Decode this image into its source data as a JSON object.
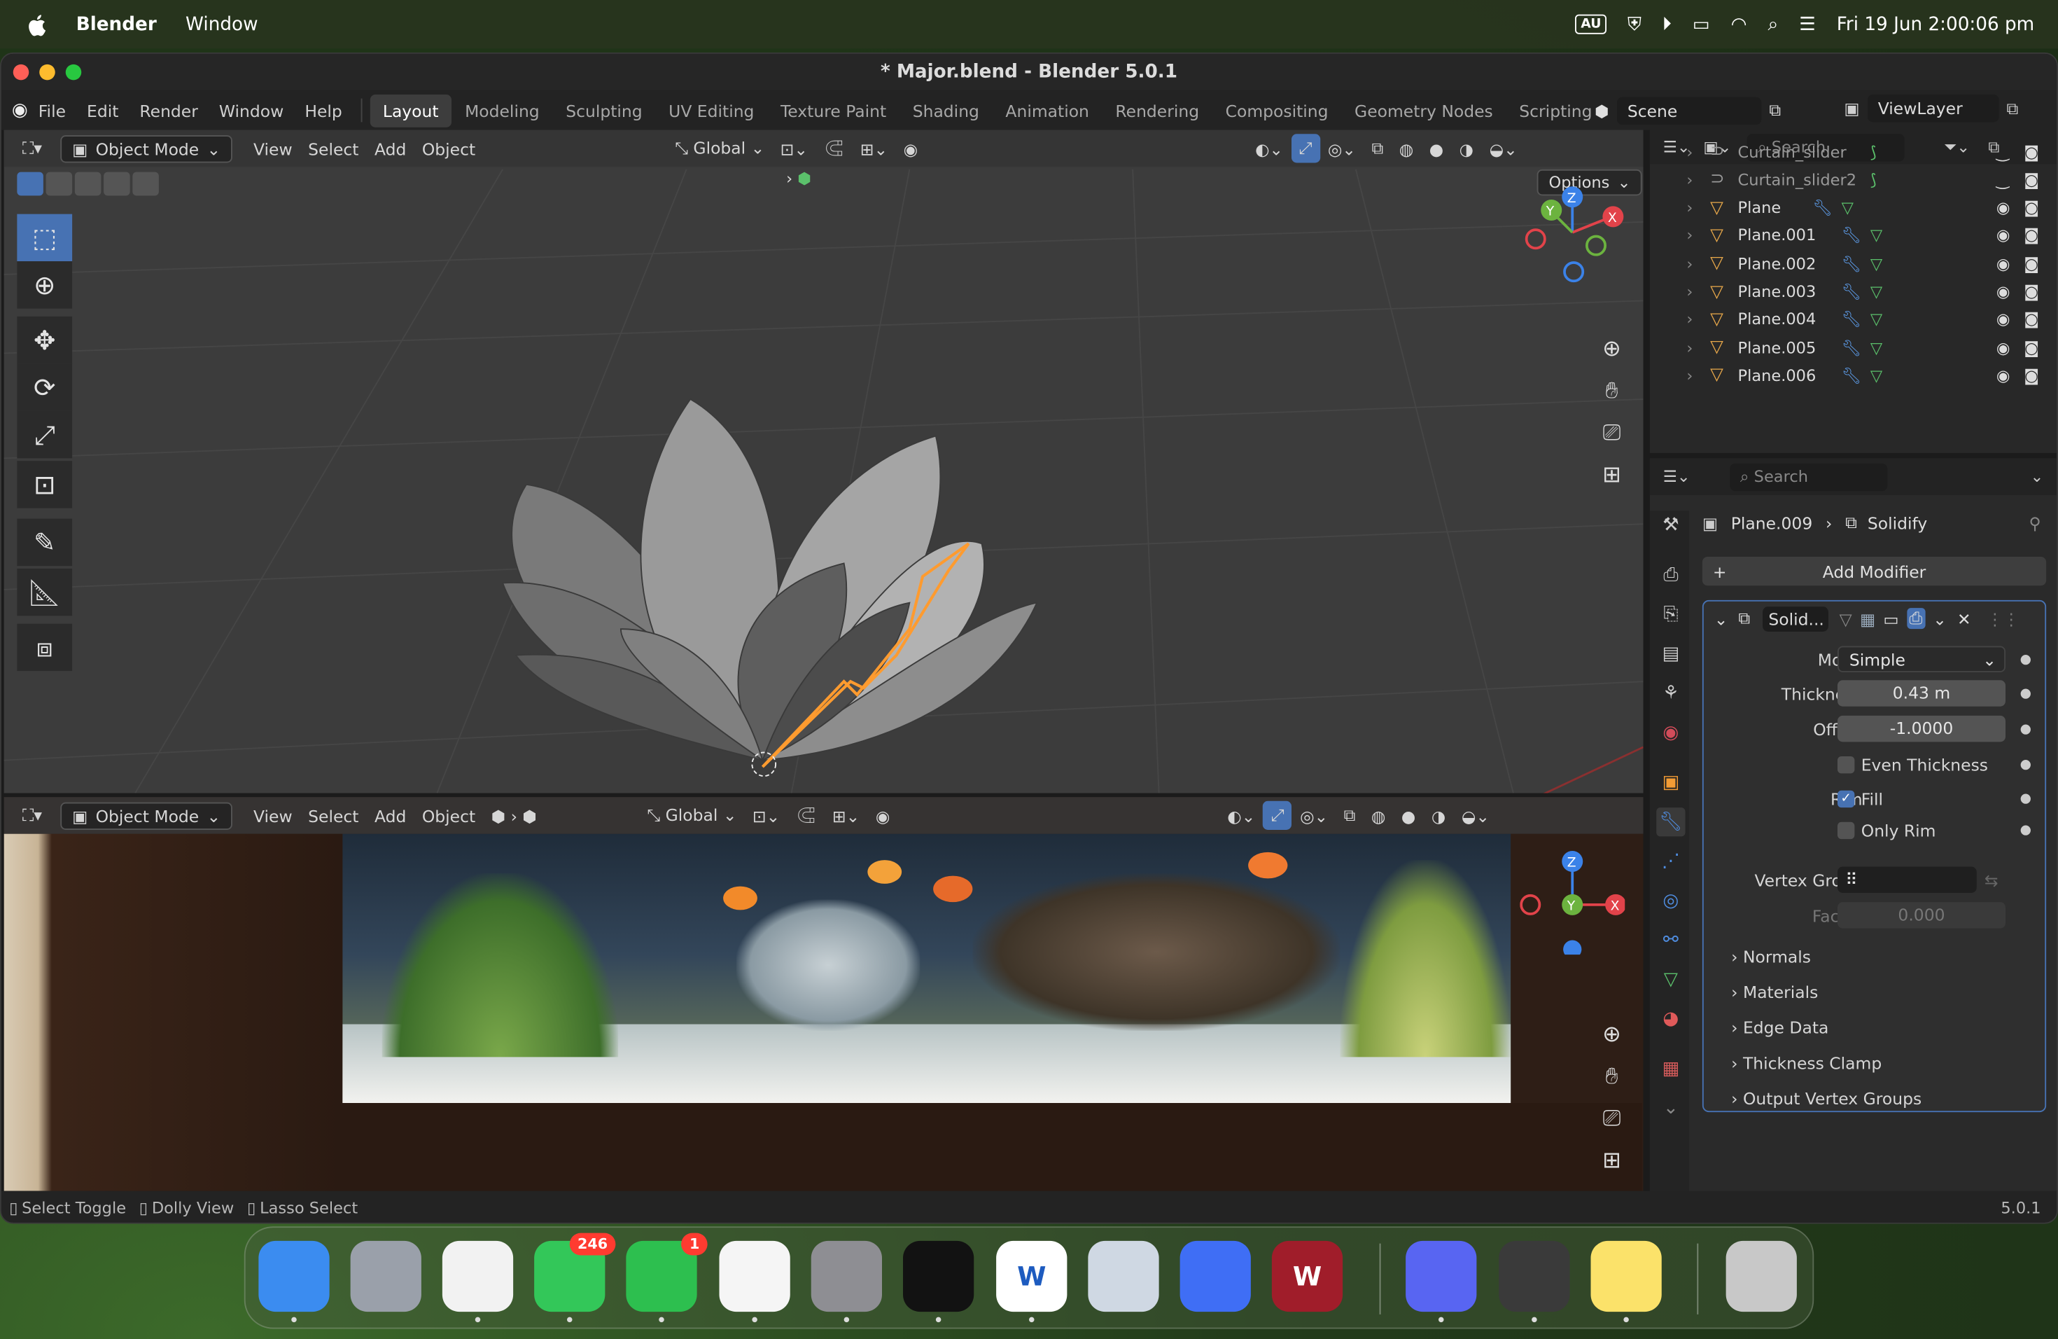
{
  "menubar": {
    "app_name": "Blender",
    "menu_window": "Window",
    "input_source": "AU",
    "datetime": "Fri 19 Jun  2:00:06 pm"
  },
  "window": {
    "title": "* Major.blend - Blender 5.0.1"
  },
  "topbar": {
    "menus": [
      "File",
      "Edit",
      "Render",
      "Window",
      "Help"
    ],
    "workspaces": [
      "Layout",
      "Modeling",
      "Sculpting",
      "UV Editing",
      "Texture Paint",
      "Shading",
      "Animation",
      "Rendering",
      "Compositing",
      "Geometry Nodes",
      "Scripting"
    ],
    "active_workspace": "Layout",
    "scene": "Scene",
    "view_layer": "ViewLayer"
  },
  "viewport_top": {
    "mode": "Object Mode",
    "menus": [
      "View",
      "Select",
      "Add",
      "Object"
    ],
    "orientation": "Global",
    "options": "Options"
  },
  "viewport_bottom": {
    "mode": "Object Mode",
    "menus": [
      "View",
      "Select",
      "Add",
      "Object"
    ],
    "orientation": "Global"
  },
  "gizmo": {
    "x": "X",
    "y": "Y",
    "z": "Z"
  },
  "outliner": {
    "search_placeholder": "Search",
    "rows": [
      {
        "name": "Curtain_slider",
        "kind": "curve"
      },
      {
        "name": "Curtain_slider2",
        "kind": "curve"
      },
      {
        "name": "Plane",
        "kind": "mesh"
      },
      {
        "name": "Plane.001",
        "kind": "mesh"
      },
      {
        "name": "Plane.002",
        "kind": "mesh"
      },
      {
        "name": "Plane.003",
        "kind": "mesh"
      },
      {
        "name": "Plane.004",
        "kind": "mesh"
      },
      {
        "name": "Plane.005",
        "kind": "mesh"
      },
      {
        "name": "Plane.006",
        "kind": "mesh"
      }
    ]
  },
  "properties": {
    "search_placeholder": "Search",
    "breadcrumb_object": "Plane.009",
    "breadcrumb_modifier": "Solidify",
    "add_modifier": "Add Modifier",
    "modifier_name": "Solid...",
    "mode_label": "Mode",
    "mode_value": "Simple",
    "thickness_label": "Thickness",
    "thickness_value": "0.43 m",
    "offset_label": "Offset",
    "offset_value": "-1.0000",
    "even_thickness": "Even Thickness",
    "rim_label": "Rim",
    "fill_label": "Fill",
    "only_rim": "Only Rim",
    "vertex_group_label": "Vertex Group",
    "factor_label": "Factor",
    "factor_value": "0.000",
    "sections": [
      "Normals",
      "Materials",
      "Edge Data",
      "Thickness Clamp",
      "Output Vertex Groups"
    ]
  },
  "statusbar": {
    "hints": [
      "Select Toggle",
      "Dolly View",
      "Lasso Select"
    ],
    "version": "5.0.1"
  },
  "dock": {
    "apps": [
      {
        "name": "Finder",
        "icon": "finder-icon",
        "color": "#3b8cf0"
      },
      {
        "name": "Launchpad",
        "icon": "launchpad-icon",
        "color": "#9aa0aa"
      },
      {
        "name": "Chrome",
        "icon": "chrome-icon",
        "color": "#f2f2f2"
      },
      {
        "name": "Messages",
        "icon": "messages-icon",
        "color": "#33c759",
        "badge": "246"
      },
      {
        "name": "FaceTime",
        "icon": "facetime-icon",
        "color": "#2dbf4f",
        "badge": "1"
      },
      {
        "name": "Photos",
        "icon": "photos-icon",
        "color": "#f5f5f5"
      },
      {
        "name": "System Settings",
        "icon": "settings-icon",
        "color": "#8e8e93"
      },
      {
        "name": "Spotify",
        "icon": "spotify-icon",
        "color": "#121212"
      },
      {
        "name": "Word",
        "icon": "word-icon",
        "color": "#ffffff",
        "glyph": "W"
      },
      {
        "name": "Preview",
        "icon": "preview-icon",
        "color": "#cfd8e3"
      },
      {
        "name": "Roblox Studio",
        "icon": "roblox-icon",
        "color": "#3f6ef5"
      },
      {
        "name": "Workbench",
        "icon": "w-shield-icon",
        "color": "#a01d2a",
        "glyph": "W"
      },
      {
        "name": "Discord",
        "icon": "discord-icon",
        "color": "#5865f2"
      },
      {
        "name": "Blender",
        "icon": "blender-icon",
        "color": "#3a3a3a"
      },
      {
        "name": "Notes",
        "icon": "notes-icon",
        "color": "#fbe26a"
      },
      {
        "name": "Trash",
        "icon": "trash-icon",
        "color": "#c8c8c8"
      }
    ]
  },
  "colors": {
    "accent": "#4772b3",
    "selection_outline": "#ff9b2f"
  }
}
